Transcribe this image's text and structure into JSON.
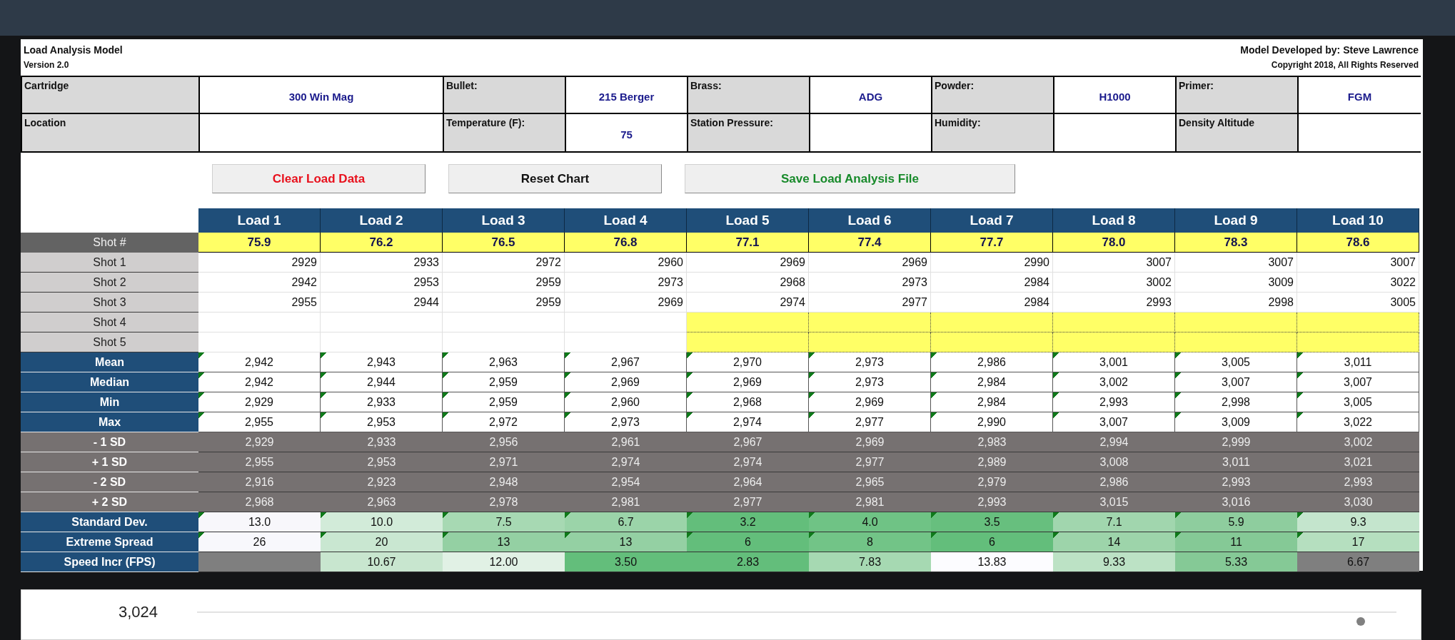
{
  "header": {
    "title": "Load Analysis Model",
    "version": "Version 2.0",
    "author": "Model Developed by: Steve Lawrence",
    "copyright": "Copyright 2018, All Rights Reserved"
  },
  "info": [
    [
      {
        "label": "Cartridge",
        "value": "300 Win Mag"
      },
      {
        "label": "Bullet:",
        "value": "215 Berger"
      },
      {
        "label": "Brass:",
        "value": "ADG"
      },
      {
        "label": "Powder:",
        "value": "H1000"
      },
      {
        "label": "Primer:",
        "value": "FGM"
      }
    ],
    [
      {
        "label": "Location"
      },
      {
        "label": "Temperature (F):",
        "value": "75"
      },
      {
        "label": "Station Pressure:"
      },
      {
        "label": "Humidity:"
      },
      {
        "label": "Density Altitude"
      }
    ]
  ],
  "buttons": [
    {
      "label": "Clear Load Data",
      "kind": "danger"
    },
    {
      "label": "Reset Chart",
      "kind": "neutral"
    },
    {
      "label": "Save Load Analysis File",
      "kind": "save"
    }
  ],
  "table": {
    "columns": [
      "Load 1",
      "Load 2",
      "Load 3",
      "Load 4",
      "Load 5",
      "Load 6",
      "Load 7",
      "Load 8",
      "Load 9",
      "Load 10"
    ],
    "charge_row": {
      "label": "Shot #",
      "values": [
        "75.9",
        "76.2",
        "76.5",
        "76.8",
        "77.1",
        "77.4",
        "77.7",
        "78.0",
        "78.3",
        "78.6"
      ]
    },
    "shot_rows": [
      {
        "label": "Shot 1",
        "cells": [
          {
            "value": "2929",
            "highlighted": false
          },
          {
            "value": "2933",
            "highlighted": false
          },
          {
            "value": "2972",
            "highlighted": false
          },
          {
            "value": "2960",
            "highlighted": false
          },
          {
            "value": "2969",
            "highlighted": false
          },
          {
            "value": "2969",
            "highlighted": false
          },
          {
            "value": "2990",
            "highlighted": false
          },
          {
            "value": "3007",
            "highlighted": false
          },
          {
            "value": "3007",
            "highlighted": false
          },
          {
            "value": "3007",
            "highlighted": false
          }
        ]
      },
      {
        "label": "Shot 2",
        "cells": [
          {
            "value": "2942",
            "highlighted": false
          },
          {
            "value": "2953",
            "highlighted": false
          },
          {
            "value": "2959",
            "highlighted": false
          },
          {
            "value": "2973",
            "highlighted": false
          },
          {
            "value": "2968",
            "highlighted": false
          },
          {
            "value": "2973",
            "highlighted": false
          },
          {
            "value": "2984",
            "highlighted": false
          },
          {
            "value": "3002",
            "highlighted": false
          },
          {
            "value": "3009",
            "highlighted": false
          },
          {
            "value": "3022",
            "highlighted": false
          }
        ]
      },
      {
        "label": "Shot 3",
        "cells": [
          {
            "value": "2955",
            "highlighted": false
          },
          {
            "value": "2944",
            "highlighted": false
          },
          {
            "value": "2959",
            "highlighted": false
          },
          {
            "value": "2969",
            "highlighted": false
          },
          {
            "value": "2974",
            "highlighted": false
          },
          {
            "value": "2977",
            "highlighted": false
          },
          {
            "value": "2984",
            "highlighted": false
          },
          {
            "value": "2993",
            "highlighted": false
          },
          {
            "value": "2998",
            "highlighted": false
          },
          {
            "value": "3005",
            "highlighted": false
          }
        ]
      },
      {
        "label": "Shot 4",
        "cells": [
          {
            "highlighted": false
          },
          {
            "highlighted": false
          },
          {
            "highlighted": false
          },
          {
            "highlighted": false
          },
          {
            "highlighted": true
          },
          {
            "highlighted": true
          },
          {
            "highlighted": true
          },
          {
            "highlighted": true
          },
          {
            "highlighted": true
          },
          {
            "highlighted": true
          }
        ]
      },
      {
        "label": "Shot 5",
        "cells": [
          {
            "highlighted": false
          },
          {
            "highlighted": false
          },
          {
            "highlighted": false
          },
          {
            "highlighted": false
          },
          {
            "highlighted": true
          },
          {
            "highlighted": true
          },
          {
            "highlighted": true
          },
          {
            "highlighted": true
          },
          {
            "highlighted": true
          },
          {
            "highlighted": true
          }
        ]
      }
    ],
    "stat_rows": [
      {
        "label": "Mean",
        "kind": "stat",
        "flagged": true,
        "cells": [
          {
            "value": "2,942"
          },
          {
            "value": "2,943"
          },
          {
            "value": "2,963"
          },
          {
            "value": "2,967"
          },
          {
            "value": "2,970"
          },
          {
            "value": "2,973"
          },
          {
            "value": "2,986"
          },
          {
            "value": "3,001"
          },
          {
            "value": "3,005"
          },
          {
            "value": "3,011"
          }
        ]
      },
      {
        "label": "Median",
        "kind": "stat",
        "flagged": true,
        "cells": [
          {
            "value": "2,942"
          },
          {
            "value": "2,944"
          },
          {
            "value": "2,959"
          },
          {
            "value": "2,969"
          },
          {
            "value": "2,969"
          },
          {
            "value": "2,973"
          },
          {
            "value": "2,984"
          },
          {
            "value": "3,002"
          },
          {
            "value": "3,007"
          },
          {
            "value": "3,007"
          }
        ]
      },
      {
        "label": "Min",
        "kind": "stat",
        "flagged": true,
        "cells": [
          {
            "value": "2,929"
          },
          {
            "value": "2,933"
          },
          {
            "value": "2,959"
          },
          {
            "value": "2,960"
          },
          {
            "value": "2,968"
          },
          {
            "value": "2,969"
          },
          {
            "value": "2,984"
          },
          {
            "value": "2,993"
          },
          {
            "value": "2,998"
          },
          {
            "value": "3,005"
          }
        ]
      },
      {
        "label": "Max",
        "kind": "stat",
        "flagged": true,
        "cells": [
          {
            "value": "2,955"
          },
          {
            "value": "2,953"
          },
          {
            "value": "2,972"
          },
          {
            "value": "2,973"
          },
          {
            "value": "2,974"
          },
          {
            "value": "2,977"
          },
          {
            "value": "2,990"
          },
          {
            "value": "3,007"
          },
          {
            "value": "3,009"
          },
          {
            "value": "3,022"
          }
        ]
      },
      {
        "label": "- 1 SD",
        "kind": "band",
        "flagged": false,
        "cells": [
          {
            "value": "2,929"
          },
          {
            "value": "2,933"
          },
          {
            "value": "2,956"
          },
          {
            "value": "2,961"
          },
          {
            "value": "2,967"
          },
          {
            "value": "2,969"
          },
          {
            "value": "2,983"
          },
          {
            "value": "2,994"
          },
          {
            "value": "2,999"
          },
          {
            "value": "3,002"
          }
        ]
      },
      {
        "label": "+ 1 SD",
        "kind": "band",
        "flagged": false,
        "cells": [
          {
            "value": "2,955"
          },
          {
            "value": "2,953"
          },
          {
            "value": "2,971"
          },
          {
            "value": "2,974"
          },
          {
            "value": "2,974"
          },
          {
            "value": "2,977"
          },
          {
            "value": "2,989"
          },
          {
            "value": "3,008"
          },
          {
            "value": "3,011"
          },
          {
            "value": "3,021"
          }
        ]
      },
      {
        "label": "- 2 SD",
        "kind": "band",
        "flagged": false,
        "cells": [
          {
            "value": "2,916"
          },
          {
            "value": "2,923"
          },
          {
            "value": "2,948"
          },
          {
            "value": "2,954"
          },
          {
            "value": "2,964"
          },
          {
            "value": "2,965"
          },
          {
            "value": "2,979"
          },
          {
            "value": "2,986"
          },
          {
            "value": "2,993"
          },
          {
            "value": "2,993"
          }
        ]
      },
      {
        "label": "+ 2 SD",
        "kind": "band",
        "flagged": false,
        "cells": [
          {
            "value": "2,968"
          },
          {
            "value": "2,963"
          },
          {
            "value": "2,978"
          },
          {
            "value": "2,981"
          },
          {
            "value": "2,977"
          },
          {
            "value": "2,981"
          },
          {
            "value": "2,993"
          },
          {
            "value": "3,015"
          },
          {
            "value": "3,016"
          },
          {
            "value": "3,030"
          }
        ]
      },
      {
        "label": "Standard Dev.",
        "kind": "heat",
        "flagged": true,
        "cells": [
          {
            "value": "13.0",
            "color": "#f8f7fb"
          },
          {
            "value": "10.0",
            "color": "#d2ebd9"
          },
          {
            "value": "7.5",
            "color": "#a7d9b3"
          },
          {
            "value": "6.7",
            "color": "#9bd4a9"
          },
          {
            "value": "3.2",
            "color": "#63be7b"
          },
          {
            "value": "4.0",
            "color": "#6fc385"
          },
          {
            "value": "3.5",
            "color": "#67bf7e"
          },
          {
            "value": "7.1",
            "color": "#a1d6ae"
          },
          {
            "value": "5.9",
            "color": "#8ecd9e"
          },
          {
            "value": "9.3",
            "color": "#c4e5cd"
          }
        ]
      },
      {
        "label": "Extreme Spread",
        "kind": "heat",
        "flagged": true,
        "cells": [
          {
            "value": "26",
            "color": "#f8f8fc"
          },
          {
            "value": "20",
            "color": "#c9e7d1"
          },
          {
            "value": "13",
            "color": "#94d0a3"
          },
          {
            "value": "13",
            "color": "#94d0a3"
          },
          {
            "value": "6",
            "color": "#63be7b"
          },
          {
            "value": "8",
            "color": "#72c487"
          },
          {
            "value": "6",
            "color": "#63be7b"
          },
          {
            "value": "14",
            "color": "#9dd4aa"
          },
          {
            "value": "11",
            "color": "#85c996"
          },
          {
            "value": "17",
            "color": "#b5dfbf"
          }
        ]
      },
      {
        "label": "Speed Incr (FPS)",
        "kind": "heat",
        "flagged": false,
        "cells": [
          {
            "color": "#7f7f7f"
          },
          {
            "value": "10.67",
            "color": "#c8e6cf"
          },
          {
            "value": "12.00",
            "color": "#e1f1e5"
          },
          {
            "value": "3.50",
            "color": "#63be7b"
          },
          {
            "value": "2.83",
            "color": "#63be7b"
          },
          {
            "value": "7.83",
            "color": "#a6d9b2"
          },
          {
            "value": "13.83",
            "color": "#fcfcff"
          },
          {
            "value": "9.33",
            "color": "#bce2c5"
          },
          {
            "value": "5.33",
            "color": "#85c996"
          },
          {
            "value": "6.67",
            "color": "#7f7f7f"
          }
        ]
      }
    ]
  },
  "chart": {
    "tick_label": "3,024"
  }
}
